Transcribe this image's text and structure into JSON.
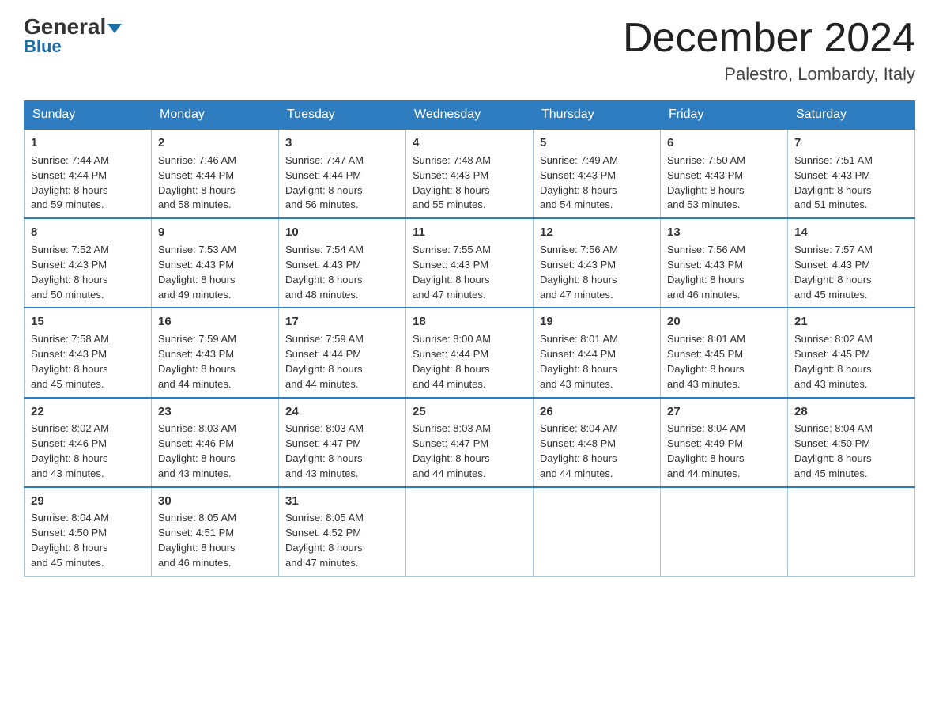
{
  "header": {
    "logo_general": "General",
    "logo_blue": "Blue",
    "month_title": "December 2024",
    "location": "Palestro, Lombardy, Italy"
  },
  "days_of_week": [
    "Sunday",
    "Monday",
    "Tuesday",
    "Wednesday",
    "Thursday",
    "Friday",
    "Saturday"
  ],
  "weeks": [
    [
      {
        "day": "1",
        "sunrise": "7:44 AM",
        "sunset": "4:44 PM",
        "daylight": "8 hours and 59 minutes."
      },
      {
        "day": "2",
        "sunrise": "7:46 AM",
        "sunset": "4:44 PM",
        "daylight": "8 hours and 58 minutes."
      },
      {
        "day": "3",
        "sunrise": "7:47 AM",
        "sunset": "4:44 PM",
        "daylight": "8 hours and 56 minutes."
      },
      {
        "day": "4",
        "sunrise": "7:48 AM",
        "sunset": "4:43 PM",
        "daylight": "8 hours and 55 minutes."
      },
      {
        "day": "5",
        "sunrise": "7:49 AM",
        "sunset": "4:43 PM",
        "daylight": "8 hours and 54 minutes."
      },
      {
        "day": "6",
        "sunrise": "7:50 AM",
        "sunset": "4:43 PM",
        "daylight": "8 hours and 53 minutes."
      },
      {
        "day": "7",
        "sunrise": "7:51 AM",
        "sunset": "4:43 PM",
        "daylight": "8 hours and 51 minutes."
      }
    ],
    [
      {
        "day": "8",
        "sunrise": "7:52 AM",
        "sunset": "4:43 PM",
        "daylight": "8 hours and 50 minutes."
      },
      {
        "day": "9",
        "sunrise": "7:53 AM",
        "sunset": "4:43 PM",
        "daylight": "8 hours and 49 minutes."
      },
      {
        "day": "10",
        "sunrise": "7:54 AM",
        "sunset": "4:43 PM",
        "daylight": "8 hours and 48 minutes."
      },
      {
        "day": "11",
        "sunrise": "7:55 AM",
        "sunset": "4:43 PM",
        "daylight": "8 hours and 47 minutes."
      },
      {
        "day": "12",
        "sunrise": "7:56 AM",
        "sunset": "4:43 PM",
        "daylight": "8 hours and 47 minutes."
      },
      {
        "day": "13",
        "sunrise": "7:56 AM",
        "sunset": "4:43 PM",
        "daylight": "8 hours and 46 minutes."
      },
      {
        "day": "14",
        "sunrise": "7:57 AM",
        "sunset": "4:43 PM",
        "daylight": "8 hours and 45 minutes."
      }
    ],
    [
      {
        "day": "15",
        "sunrise": "7:58 AM",
        "sunset": "4:43 PM",
        "daylight": "8 hours and 45 minutes."
      },
      {
        "day": "16",
        "sunrise": "7:59 AM",
        "sunset": "4:43 PM",
        "daylight": "8 hours and 44 minutes."
      },
      {
        "day": "17",
        "sunrise": "7:59 AM",
        "sunset": "4:44 PM",
        "daylight": "8 hours and 44 minutes."
      },
      {
        "day": "18",
        "sunrise": "8:00 AM",
        "sunset": "4:44 PM",
        "daylight": "8 hours and 44 minutes."
      },
      {
        "day": "19",
        "sunrise": "8:01 AM",
        "sunset": "4:44 PM",
        "daylight": "8 hours and 43 minutes."
      },
      {
        "day": "20",
        "sunrise": "8:01 AM",
        "sunset": "4:45 PM",
        "daylight": "8 hours and 43 minutes."
      },
      {
        "day": "21",
        "sunrise": "8:02 AM",
        "sunset": "4:45 PM",
        "daylight": "8 hours and 43 minutes."
      }
    ],
    [
      {
        "day": "22",
        "sunrise": "8:02 AM",
        "sunset": "4:46 PM",
        "daylight": "8 hours and 43 minutes."
      },
      {
        "day": "23",
        "sunrise": "8:03 AM",
        "sunset": "4:46 PM",
        "daylight": "8 hours and 43 minutes."
      },
      {
        "day": "24",
        "sunrise": "8:03 AM",
        "sunset": "4:47 PM",
        "daylight": "8 hours and 43 minutes."
      },
      {
        "day": "25",
        "sunrise": "8:03 AM",
        "sunset": "4:47 PM",
        "daylight": "8 hours and 44 minutes."
      },
      {
        "day": "26",
        "sunrise": "8:04 AM",
        "sunset": "4:48 PM",
        "daylight": "8 hours and 44 minutes."
      },
      {
        "day": "27",
        "sunrise": "8:04 AM",
        "sunset": "4:49 PM",
        "daylight": "8 hours and 44 minutes."
      },
      {
        "day": "28",
        "sunrise": "8:04 AM",
        "sunset": "4:50 PM",
        "daylight": "8 hours and 45 minutes."
      }
    ],
    [
      {
        "day": "29",
        "sunrise": "8:04 AM",
        "sunset": "4:50 PM",
        "daylight": "8 hours and 45 minutes."
      },
      {
        "day": "30",
        "sunrise": "8:05 AM",
        "sunset": "4:51 PM",
        "daylight": "8 hours and 46 minutes."
      },
      {
        "day": "31",
        "sunrise": "8:05 AM",
        "sunset": "4:52 PM",
        "daylight": "8 hours and 47 minutes."
      },
      null,
      null,
      null,
      null
    ]
  ],
  "labels": {
    "sunrise": "Sunrise: ",
    "sunset": "Sunset: ",
    "daylight": "Daylight: "
  }
}
